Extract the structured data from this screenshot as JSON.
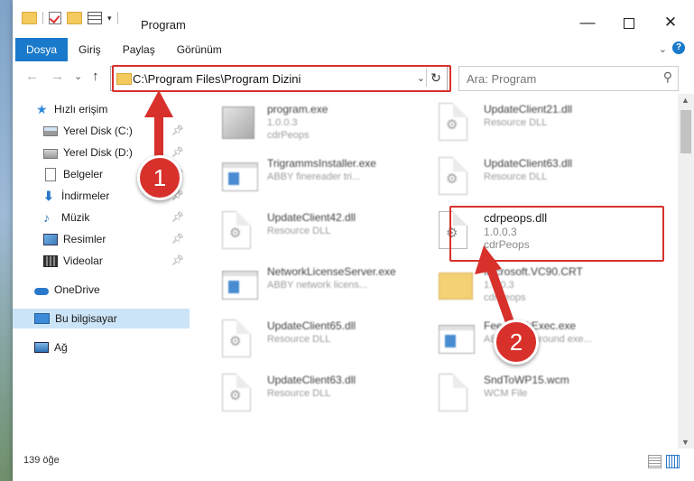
{
  "titlebar": {
    "title": "Program",
    "min_glyph": "—",
    "close_glyph": "✕"
  },
  "ribbon": {
    "tabs": [
      {
        "label": "Dosya",
        "active": true
      },
      {
        "label": "Giriş"
      },
      {
        "label": "Paylaş"
      },
      {
        "label": "Görünüm"
      }
    ]
  },
  "nav": {
    "back": "←",
    "forward": "→",
    "recent": "⌄",
    "up": "↑",
    "address": "C:\\Program Files\\Program Dizini",
    "dropdown": "⌄",
    "refresh": "↻",
    "search_placeholder": "Ara: Program",
    "search_glyph": "⚲"
  },
  "sidebar": {
    "items": [
      {
        "label": "Hızlı erişim",
        "icon": "star-icon"
      },
      {
        "label": "Yerel Disk (C:)",
        "icon": "drive-icon",
        "pinned": true
      },
      {
        "label": "Yerel Disk (D:)",
        "icon": "drive-icon",
        "pinned": true
      },
      {
        "label": "Belgeler",
        "icon": "documents-icon",
        "pinned": true
      },
      {
        "label": "İndirmeler",
        "icon": "download-icon",
        "pinned": true
      },
      {
        "label": "Müzik",
        "icon": "music-icon",
        "pinned": true
      },
      {
        "label": "Resimler",
        "icon": "pictures-icon",
        "pinned": true
      },
      {
        "label": "Videolar",
        "icon": "videos-icon",
        "pinned": true
      },
      {
        "label": "OneDrive",
        "icon": "cloud-icon"
      },
      {
        "label": "Bu bilgisayar",
        "icon": "computer-icon",
        "selected": true
      },
      {
        "label": "Ağ",
        "icon": "network-icon"
      }
    ]
  },
  "files": [
    {
      "name": "program.exe",
      "line2": "1.0.0.3",
      "line3": "cdrPeops"
    },
    {
      "name": "UpdateClient21.dll",
      "line2": "Resource DLL",
      "line3": ""
    },
    {
      "name": "TrigrammsInstaller.exe",
      "line2": "ABBY finereader tri...",
      "line3": ""
    },
    {
      "name": "UpdateClient63.dll",
      "line2": "Resource DLL",
      "line3": ""
    },
    {
      "name": "UpdateClient42.dll",
      "line2": "Resource DLL",
      "line3": ""
    },
    {
      "name": "cdrpeops.dll",
      "line2": "1.0.0.3",
      "line3": "cdrPeops"
    },
    {
      "name": "NetworkLicenseServer.exe",
      "line2": "ABBY network licens...",
      "line3": ""
    },
    {
      "name": "Microsoft.VC90.CRT",
      "line2": "1.0.0.3",
      "line3": "cdrPeops"
    },
    {
      "name": "UpdateClient65.dll",
      "line2": "Resource DLL",
      "line3": ""
    },
    {
      "name": "FeedbackExec.exe",
      "line2": "ABBY background exe...",
      "line3": ""
    },
    {
      "name": "UpdateClient63.dll",
      "line2": "Resource DLL",
      "line3": ""
    },
    {
      "name": "SndToWP15.wcm",
      "line2": "WCM File",
      "line3": ""
    }
  ],
  "status": {
    "count": "139 öğe"
  },
  "callouts": {
    "step1": "1",
    "step2": "2",
    "color": "#d8302b"
  }
}
